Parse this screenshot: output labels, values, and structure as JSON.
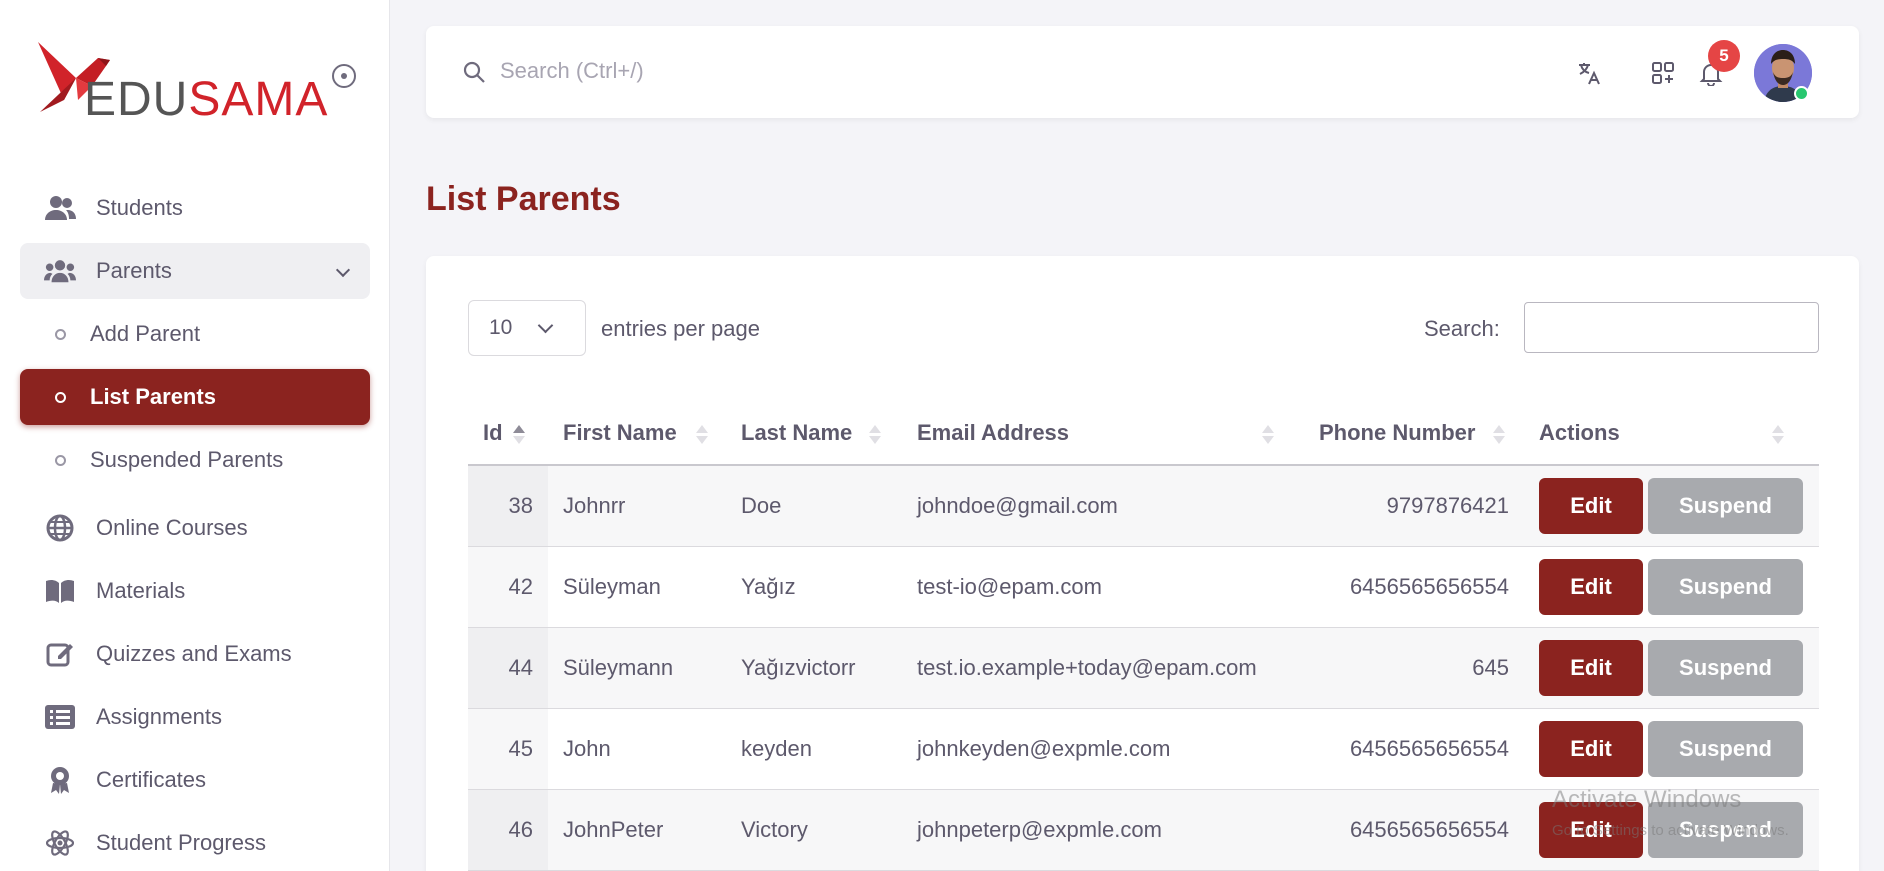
{
  "brand": {
    "name_part1": "EDU",
    "name_part2": "SAMA"
  },
  "sidebar": {
    "items": [
      {
        "label": "Students",
        "icon": "users-icon"
      },
      {
        "label": "Parents",
        "icon": "users-group-icon"
      },
      {
        "label": "Online Courses",
        "icon": "globe-icon"
      },
      {
        "label": "Materials",
        "icon": "book-icon"
      },
      {
        "label": "Quizzes and Exams",
        "icon": "edit-icon"
      },
      {
        "label": "Assignments",
        "icon": "list-icon"
      },
      {
        "label": "Certificates",
        "icon": "award-icon"
      },
      {
        "label": "Student Progress",
        "icon": "atom-icon"
      }
    ],
    "parents_sub": [
      {
        "label": "Add Parent"
      },
      {
        "label": "List Parents"
      },
      {
        "label": "Suspended Parents"
      }
    ]
  },
  "topbar": {
    "search_placeholder": "Search (Ctrl+/)",
    "notifications_count": "5"
  },
  "page": {
    "title": "List Parents"
  },
  "table_controls": {
    "page_length": "10",
    "page_length_label": "entries per page",
    "search_label": "Search:"
  },
  "table": {
    "columns": [
      "Id",
      "First Name",
      "Last Name",
      "Email Address",
      "Phone Number",
      "Actions"
    ],
    "rows": [
      {
        "id": "38",
        "first": "Johnrr",
        "last": "Doe",
        "email": "johndoe@gmail.com",
        "phone": "9797876421"
      },
      {
        "id": "42",
        "first": "Süleyman",
        "last": "Yağız",
        "email": "test-io@epam.com",
        "phone": "6456565656554"
      },
      {
        "id": "44",
        "first": "Süleymann",
        "last": "Yağızvictorr",
        "email": "test.io.example+today@epam.com",
        "phone": "645"
      },
      {
        "id": "45",
        "first": "John",
        "last": "keyden",
        "email": "johnkeyden@expmle.com",
        "phone": "6456565656554"
      },
      {
        "id": "46",
        "first": "JohnPeter",
        "last": "Victory",
        "email": "johnpeterp@expmle.com",
        "phone": "6456565656554"
      }
    ],
    "edit_label": "Edit",
    "suspend_label": "Suspend"
  },
  "watermark": {
    "line1": "Activate Windows",
    "line2": "Go to Settings to activate Windows."
  },
  "colors": {
    "accent": "#8b231f",
    "suspend": "#a8aaae",
    "badge": "#e54545"
  }
}
